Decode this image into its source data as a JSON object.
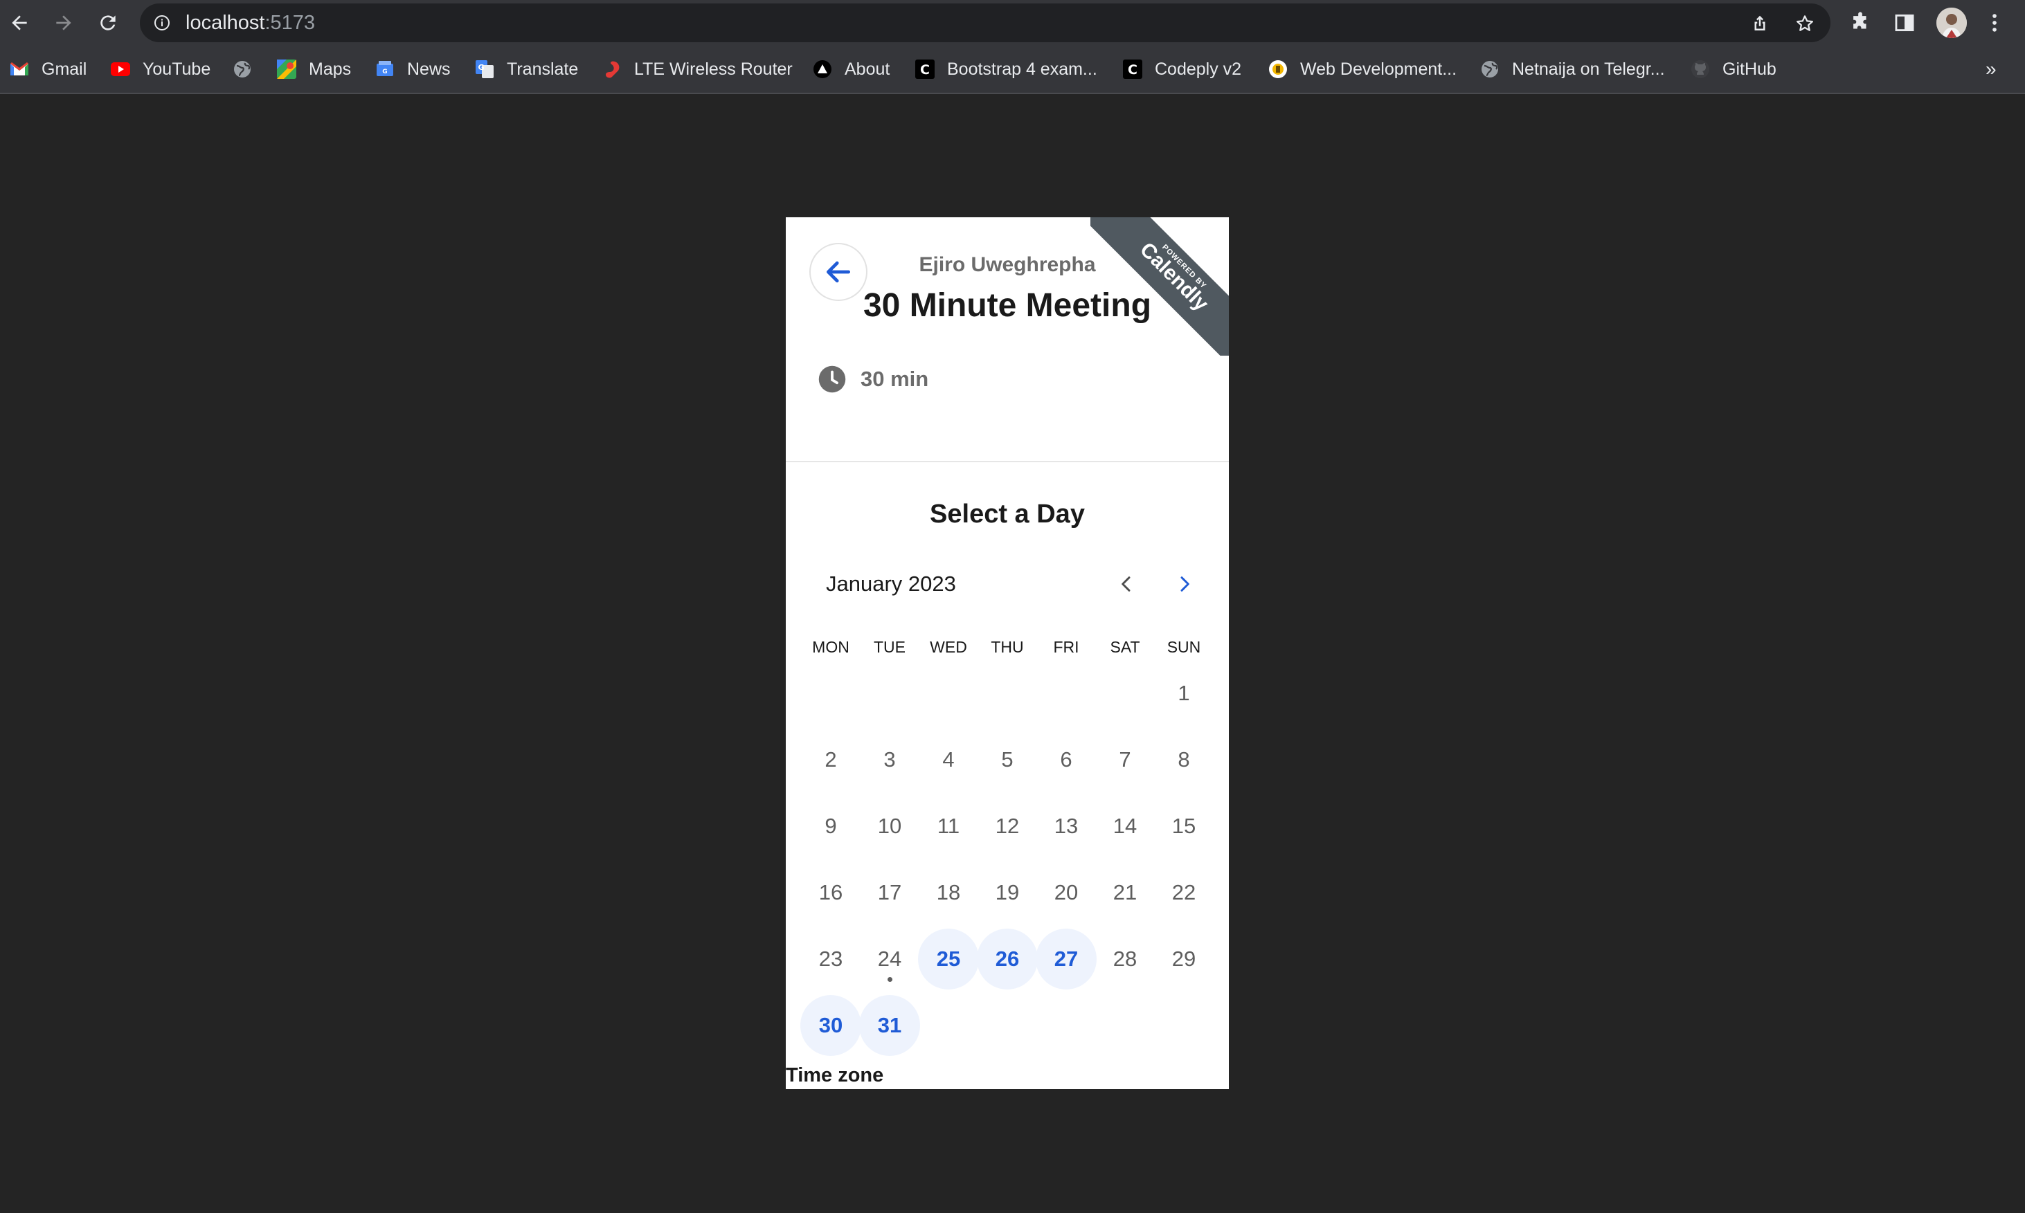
{
  "browser": {
    "url_host": "localhost",
    "url_port": ":5173",
    "bookmarks": [
      {
        "label": "Gmail",
        "icon": "gmail-icon"
      },
      {
        "label": "YouTube",
        "icon": "youtube-icon"
      },
      {
        "label": "",
        "icon": "globe-icon"
      },
      {
        "label": "Maps",
        "icon": "maps-icon"
      },
      {
        "label": "News",
        "icon": "news-icon"
      },
      {
        "label": "Translate",
        "icon": "translate-icon"
      },
      {
        "label": "LTE Wireless Router",
        "icon": "router-icon"
      },
      {
        "label": "About",
        "icon": "about-icon"
      },
      {
        "label": "Bootstrap 4 exam...",
        "icon": "codeply-icon"
      },
      {
        "label": "Codeply v2",
        "icon": "codeply-icon"
      },
      {
        "label": "Web Development...",
        "icon": "webdev-icon"
      },
      {
        "label": "Netnaija on Telegr...",
        "icon": "globe-icon"
      },
      {
        "label": "GitHub",
        "icon": "github-icon"
      }
    ],
    "more_label": "»"
  },
  "widget": {
    "ribbon_small": "POWERED BY",
    "ribbon_big": "Calendly",
    "host_name": "Ejiro Uweghrepha",
    "event_title": "30 Minute Meeting",
    "duration": "30 min",
    "select_title": "Select a Day",
    "month_label": "January 2023",
    "weekdays": [
      "MON",
      "TUE",
      "WED",
      "THU",
      "FRI",
      "SAT",
      "SUN"
    ],
    "first_weekday_index": 6,
    "days_in_month": 31,
    "available_days": [
      25,
      26,
      27,
      30,
      31
    ],
    "today": 24,
    "timezone_label": "Time zone"
  },
  "colors": {
    "accent": "#1f5bd6",
    "available_bg": "#eef3fd",
    "ribbon": "#505960",
    "page_bg": "#242424"
  }
}
